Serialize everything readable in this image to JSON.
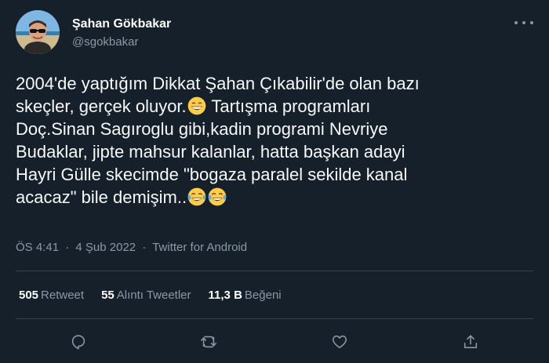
{
  "author": {
    "display_name": "Şahan Gökbakar",
    "handle": "@sgokbakar"
  },
  "tweet": {
    "line1": "2004'de yaptığım Dikkat Şahan Çıkabilir'de olan bazı",
    "line2a": "skeçler, gerçek oluyor.",
    "line2b": " Tartışma programları",
    "line3": "Doç.Sinan Sagıroglu gibi,kadin programi Nevriye",
    "line4": "Budaklar, jipte mahsur kalanlar, hatta başkan adayi",
    "line5": "Hayri Gülle skecimde \"bogaza paralel sekilde kanal",
    "line6": "acacaz\" bile demişim..",
    "emojis": [
      "grinning-face-with-smiling-eyes",
      "face-with-tears-of-joy",
      "face-with-tears-of-joy"
    ]
  },
  "meta": {
    "time": "ÖS 4:41",
    "date": "4 Şub 2022",
    "source": "Twitter for Android",
    "separator": "·"
  },
  "stats": {
    "retweets_count": "505",
    "retweets_label": "Retweet",
    "quotes_count": "55",
    "quotes_label": "Alıntı Tweetler",
    "likes_count": "11,3 B",
    "likes_label": "Beğeni"
  },
  "colors": {
    "background": "#15202b",
    "secondary_text": "#8b98a5",
    "divider": "#38444d",
    "emoji_yellow": "#ffcc4d",
    "tear_blue": "#5dadec"
  }
}
